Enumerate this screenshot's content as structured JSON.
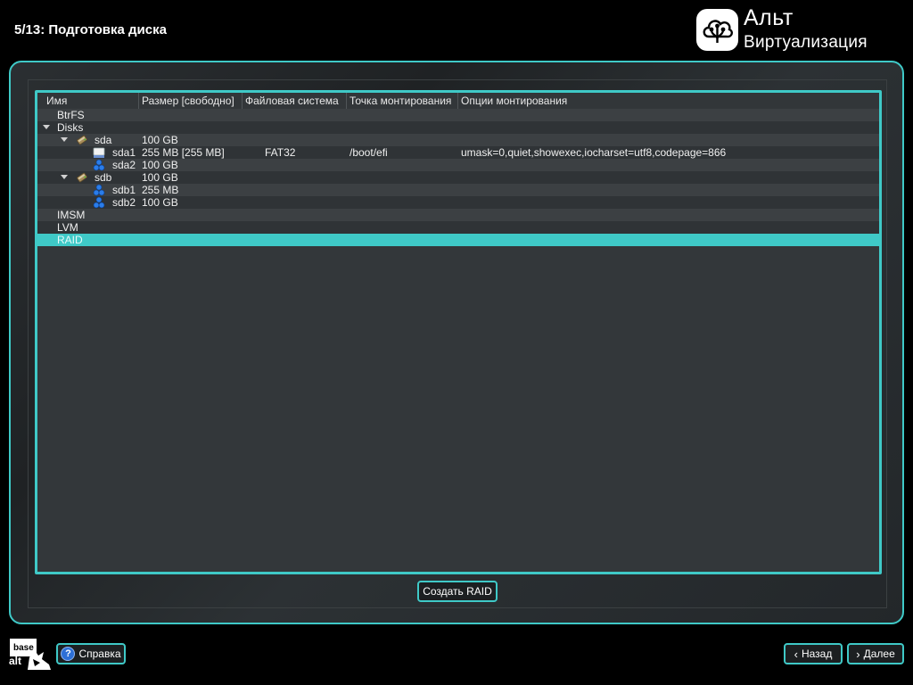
{
  "step": {
    "title": "5/13: Подготовка диска"
  },
  "brand": {
    "line1": "Альт",
    "line2": "Виртуализация"
  },
  "table": {
    "columns": [
      "Имя",
      "Размер [свободно]",
      "Файловая система",
      "Точка монтирования",
      "Опции монтирования"
    ],
    "rows": [
      {
        "name": "BtrFS",
        "size": "",
        "fs": "",
        "mount": "",
        "options": ""
      },
      {
        "name": "Disks",
        "size": "",
        "fs": "",
        "mount": "",
        "options": ""
      },
      {
        "name": "sda",
        "size": "100 GB",
        "fs": "",
        "mount": "",
        "options": ""
      },
      {
        "name": "sda1",
        "size": "255 MB [255 MB]",
        "fs": "FAT32",
        "mount": "/boot/efi",
        "options": "umask=0,quiet,showexec,iocharset=utf8,codepage=866"
      },
      {
        "name": "sda2",
        "size": "100 GB",
        "fs": "",
        "mount": "",
        "options": ""
      },
      {
        "name": "sdb",
        "size": "100 GB",
        "fs": "",
        "mount": "",
        "options": ""
      },
      {
        "name": "sdb1",
        "size": "255 MB",
        "fs": "",
        "mount": "",
        "options": ""
      },
      {
        "name": "sdb2",
        "size": "100 GB",
        "fs": "",
        "mount": "",
        "options": ""
      },
      {
        "name": "IMSM",
        "size": "",
        "fs": "",
        "mount": "",
        "options": ""
      },
      {
        "name": "LVM",
        "size": "",
        "fs": "",
        "mount": "",
        "options": ""
      },
      {
        "name": "RAID",
        "size": "",
        "fs": "",
        "mount": "",
        "options": ""
      }
    ],
    "selected": "RAID"
  },
  "actions": {
    "create_raid": "Создать RAID"
  },
  "footer": {
    "help": "Справка",
    "back": "Назад",
    "next": "Далее",
    "base_logo_top": "base",
    "base_logo_bottom": "alt"
  },
  "colors": {
    "accent": "#3fc9c7",
    "background": "#000000",
    "panel": "#33373a"
  },
  "icons": {
    "disk": "hard-disk-icon",
    "efi_partition": "removable-drive-icon",
    "partition": "cluster-partition-icon",
    "help": "help-question-icon"
  }
}
